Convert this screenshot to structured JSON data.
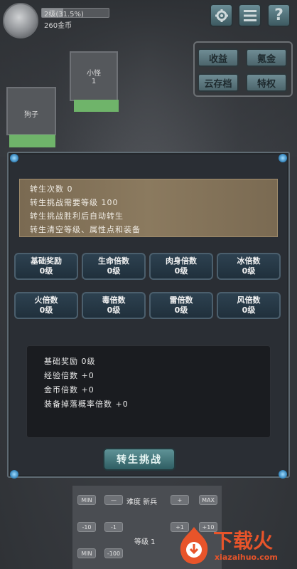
{
  "top": {
    "level_text": "2级(31.5%)",
    "level_progress": 0.315,
    "gold_text": "260金币",
    "icons": [
      "gear-icon",
      "menu-icon",
      "help-icon"
    ],
    "help_label": "?"
  },
  "menu": {
    "income": "收益",
    "krypton": "氪金",
    "cloud_save": "云存档",
    "privilege": "特权"
  },
  "enemies": [
    {
      "name": "小怪",
      "count": "1"
    },
    {
      "name": "狗子"
    }
  ],
  "rebirth": {
    "info": [
      "转生次数 0",
      "转生挑战需要等级 100",
      "转生挑战胜利后自动转生",
      "转生清空等级、属性点和装备"
    ],
    "multipliers": [
      {
        "name": "基础奖励",
        "level": "0级"
      },
      {
        "name": "生命倍数",
        "level": "0级"
      },
      {
        "name": "肉身倍数",
        "level": "0级"
      },
      {
        "name": "冰倍数",
        "level": "0级"
      },
      {
        "name": "火倍数",
        "level": "0级"
      },
      {
        "name": "毒倍数",
        "level": "0级"
      },
      {
        "name": "雷倍数",
        "level": "0级"
      },
      {
        "name": "风倍数",
        "level": "0级"
      }
    ],
    "stats": [
      "基础奖励 0级",
      "经验倍数 +0",
      "金币倍数 +0",
      "装备掉落概率倍数 +0"
    ],
    "challenge_button": "转生挑战"
  },
  "controls": {
    "min": "MIN",
    "minus": "—",
    "difficulty_label": "难度 新兵",
    "plus": "+",
    "max": "MAX",
    "minus10": "-10",
    "minus1": "-1",
    "plus1": "+1",
    "plus10": "+10",
    "level_label": "等级 1",
    "minus100": "-100"
  },
  "watermark": {
    "brand": "下载火",
    "url": "xiazaihuo.com"
  },
  "colors": {
    "accent_teal": "#5f9397",
    "hp_green": "#6fb46a",
    "info_bg": "#8b7a5f",
    "watermark": "#e8542a"
  }
}
